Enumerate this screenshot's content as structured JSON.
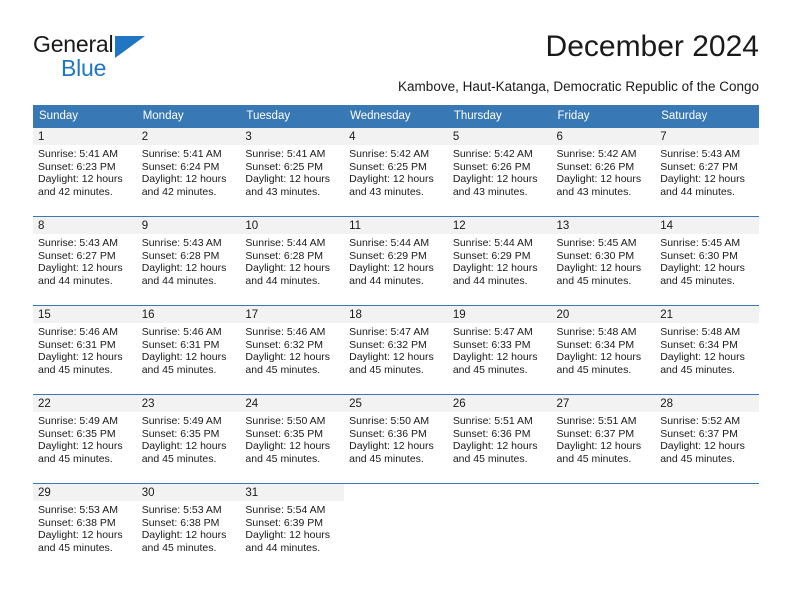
{
  "brand": {
    "name_top": "General",
    "name_bottom": "Blue",
    "triangle_color": "#1f77c4",
    "text_color": "#1a1a1a"
  },
  "header": {
    "month_title": "December 2024",
    "location": "Kambove, Haut-Katanga, Democratic Republic of the Congo"
  },
  "theme": {
    "header_row_background": "#3878b4",
    "header_row_text": "#ffffff",
    "day_band_background": "#f2f2f2",
    "cell_background": "#ffffff",
    "row_divider": "#3878b4"
  },
  "weekday_headers": [
    "Sunday",
    "Monday",
    "Tuesday",
    "Wednesday",
    "Thursday",
    "Friday",
    "Saturday"
  ],
  "weeks": [
    [
      {
        "day": "1",
        "sunrise": "Sunrise: 5:41 AM",
        "sunset": "Sunset: 6:23 PM",
        "daylight_line1": "Daylight: 12 hours",
        "daylight_line2": "and 42 minutes."
      },
      {
        "day": "2",
        "sunrise": "Sunrise: 5:41 AM",
        "sunset": "Sunset: 6:24 PM",
        "daylight_line1": "Daylight: 12 hours",
        "daylight_line2": "and 42 minutes."
      },
      {
        "day": "3",
        "sunrise": "Sunrise: 5:41 AM",
        "sunset": "Sunset: 6:25 PM",
        "daylight_line1": "Daylight: 12 hours",
        "daylight_line2": "and 43 minutes."
      },
      {
        "day": "4",
        "sunrise": "Sunrise: 5:42 AM",
        "sunset": "Sunset: 6:25 PM",
        "daylight_line1": "Daylight: 12 hours",
        "daylight_line2": "and 43 minutes."
      },
      {
        "day": "5",
        "sunrise": "Sunrise: 5:42 AM",
        "sunset": "Sunset: 6:26 PM",
        "daylight_line1": "Daylight: 12 hours",
        "daylight_line2": "and 43 minutes."
      },
      {
        "day": "6",
        "sunrise": "Sunrise: 5:42 AM",
        "sunset": "Sunset: 6:26 PM",
        "daylight_line1": "Daylight: 12 hours",
        "daylight_line2": "and 43 minutes."
      },
      {
        "day": "7",
        "sunrise": "Sunrise: 5:43 AM",
        "sunset": "Sunset: 6:27 PM",
        "daylight_line1": "Daylight: 12 hours",
        "daylight_line2": "and 44 minutes."
      }
    ],
    [
      {
        "day": "8",
        "sunrise": "Sunrise: 5:43 AM",
        "sunset": "Sunset: 6:27 PM",
        "daylight_line1": "Daylight: 12 hours",
        "daylight_line2": "and 44 minutes."
      },
      {
        "day": "9",
        "sunrise": "Sunrise: 5:43 AM",
        "sunset": "Sunset: 6:28 PM",
        "daylight_line1": "Daylight: 12 hours",
        "daylight_line2": "and 44 minutes."
      },
      {
        "day": "10",
        "sunrise": "Sunrise: 5:44 AM",
        "sunset": "Sunset: 6:28 PM",
        "daylight_line1": "Daylight: 12 hours",
        "daylight_line2": "and 44 minutes."
      },
      {
        "day": "11",
        "sunrise": "Sunrise: 5:44 AM",
        "sunset": "Sunset: 6:29 PM",
        "daylight_line1": "Daylight: 12 hours",
        "daylight_line2": "and 44 minutes."
      },
      {
        "day": "12",
        "sunrise": "Sunrise: 5:44 AM",
        "sunset": "Sunset: 6:29 PM",
        "daylight_line1": "Daylight: 12 hours",
        "daylight_line2": "and 44 minutes."
      },
      {
        "day": "13",
        "sunrise": "Sunrise: 5:45 AM",
        "sunset": "Sunset: 6:30 PM",
        "daylight_line1": "Daylight: 12 hours",
        "daylight_line2": "and 45 minutes."
      },
      {
        "day": "14",
        "sunrise": "Sunrise: 5:45 AM",
        "sunset": "Sunset: 6:30 PM",
        "daylight_line1": "Daylight: 12 hours",
        "daylight_line2": "and 45 minutes."
      }
    ],
    [
      {
        "day": "15",
        "sunrise": "Sunrise: 5:46 AM",
        "sunset": "Sunset: 6:31 PM",
        "daylight_line1": "Daylight: 12 hours",
        "daylight_line2": "and 45 minutes."
      },
      {
        "day": "16",
        "sunrise": "Sunrise: 5:46 AM",
        "sunset": "Sunset: 6:31 PM",
        "daylight_line1": "Daylight: 12 hours",
        "daylight_line2": "and 45 minutes."
      },
      {
        "day": "17",
        "sunrise": "Sunrise: 5:46 AM",
        "sunset": "Sunset: 6:32 PM",
        "daylight_line1": "Daylight: 12 hours",
        "daylight_line2": "and 45 minutes."
      },
      {
        "day": "18",
        "sunrise": "Sunrise: 5:47 AM",
        "sunset": "Sunset: 6:32 PM",
        "daylight_line1": "Daylight: 12 hours",
        "daylight_line2": "and 45 minutes."
      },
      {
        "day": "19",
        "sunrise": "Sunrise: 5:47 AM",
        "sunset": "Sunset: 6:33 PM",
        "daylight_line1": "Daylight: 12 hours",
        "daylight_line2": "and 45 minutes."
      },
      {
        "day": "20",
        "sunrise": "Sunrise: 5:48 AM",
        "sunset": "Sunset: 6:34 PM",
        "daylight_line1": "Daylight: 12 hours",
        "daylight_line2": "and 45 minutes."
      },
      {
        "day": "21",
        "sunrise": "Sunrise: 5:48 AM",
        "sunset": "Sunset: 6:34 PM",
        "daylight_line1": "Daylight: 12 hours",
        "daylight_line2": "and 45 minutes."
      }
    ],
    [
      {
        "day": "22",
        "sunrise": "Sunrise: 5:49 AM",
        "sunset": "Sunset: 6:35 PM",
        "daylight_line1": "Daylight: 12 hours",
        "daylight_line2": "and 45 minutes."
      },
      {
        "day": "23",
        "sunrise": "Sunrise: 5:49 AM",
        "sunset": "Sunset: 6:35 PM",
        "daylight_line1": "Daylight: 12 hours",
        "daylight_line2": "and 45 minutes."
      },
      {
        "day": "24",
        "sunrise": "Sunrise: 5:50 AM",
        "sunset": "Sunset: 6:35 PM",
        "daylight_line1": "Daylight: 12 hours",
        "daylight_line2": "and 45 minutes."
      },
      {
        "day": "25",
        "sunrise": "Sunrise: 5:50 AM",
        "sunset": "Sunset: 6:36 PM",
        "daylight_line1": "Daylight: 12 hours",
        "daylight_line2": "and 45 minutes."
      },
      {
        "day": "26",
        "sunrise": "Sunrise: 5:51 AM",
        "sunset": "Sunset: 6:36 PM",
        "daylight_line1": "Daylight: 12 hours",
        "daylight_line2": "and 45 minutes."
      },
      {
        "day": "27",
        "sunrise": "Sunrise: 5:51 AM",
        "sunset": "Sunset: 6:37 PM",
        "daylight_line1": "Daylight: 12 hours",
        "daylight_line2": "and 45 minutes."
      },
      {
        "day": "28",
        "sunrise": "Sunrise: 5:52 AM",
        "sunset": "Sunset: 6:37 PM",
        "daylight_line1": "Daylight: 12 hours",
        "daylight_line2": "and 45 minutes."
      }
    ],
    [
      {
        "day": "29",
        "sunrise": "Sunrise: 5:53 AM",
        "sunset": "Sunset: 6:38 PM",
        "daylight_line1": "Daylight: 12 hours",
        "daylight_line2": "and 45 minutes."
      },
      {
        "day": "30",
        "sunrise": "Sunrise: 5:53 AM",
        "sunset": "Sunset: 6:38 PM",
        "daylight_line1": "Daylight: 12 hours",
        "daylight_line2": "and 45 minutes."
      },
      {
        "day": "31",
        "sunrise": "Sunrise: 5:54 AM",
        "sunset": "Sunset: 6:39 PM",
        "daylight_line1": "Daylight: 12 hours",
        "daylight_line2": "and 44 minutes."
      },
      {
        "day": "",
        "sunrise": "",
        "sunset": "",
        "daylight_line1": "",
        "daylight_line2": ""
      },
      {
        "day": "",
        "sunrise": "",
        "sunset": "",
        "daylight_line1": "",
        "daylight_line2": ""
      },
      {
        "day": "",
        "sunrise": "",
        "sunset": "",
        "daylight_line1": "",
        "daylight_line2": ""
      },
      {
        "day": "",
        "sunrise": "",
        "sunset": "",
        "daylight_line1": "",
        "daylight_line2": ""
      }
    ]
  ]
}
